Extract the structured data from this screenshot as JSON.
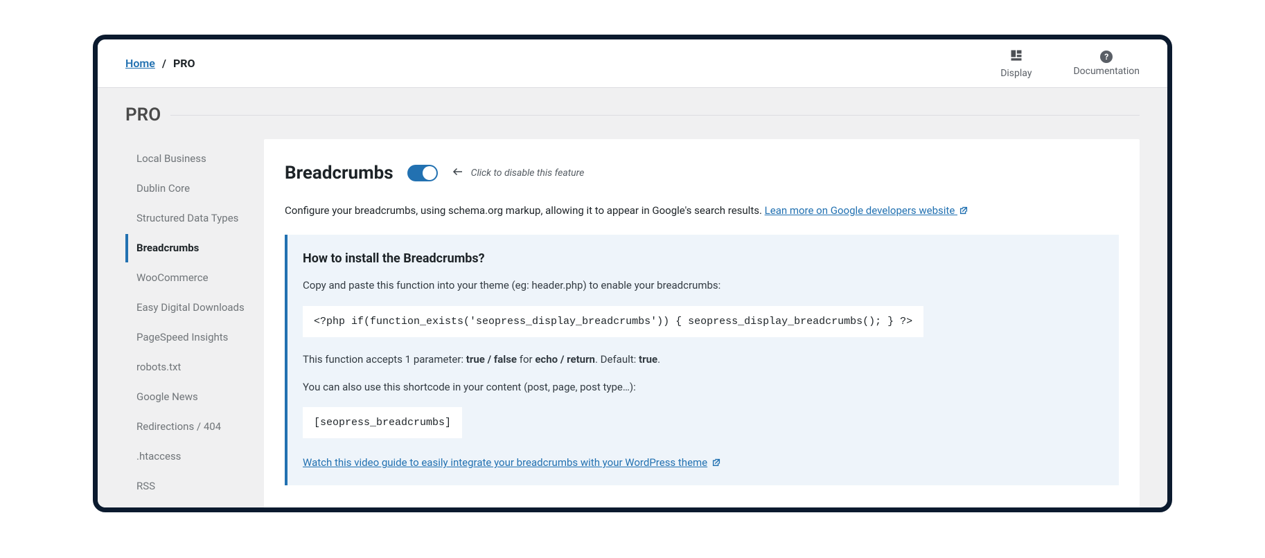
{
  "breadcrumb": {
    "home": "Home",
    "separator": "/",
    "current": "PRO"
  },
  "topbar": {
    "display": "Display",
    "documentation": "Documentation"
  },
  "page_title": "PRO",
  "sidebar": {
    "items": [
      {
        "label": "Local Business",
        "active": false
      },
      {
        "label": "Dublin Core",
        "active": false
      },
      {
        "label": "Structured Data Types",
        "active": false
      },
      {
        "label": "Breadcrumbs",
        "active": true
      },
      {
        "label": "WooCommerce",
        "active": false
      },
      {
        "label": "Easy Digital Downloads",
        "active": false
      },
      {
        "label": "PageSpeed Insights",
        "active": false
      },
      {
        "label": "robots.txt",
        "active": false
      },
      {
        "label": "Google News",
        "active": false
      },
      {
        "label": "Redirections / 404",
        "active": false
      },
      {
        "label": ".htaccess",
        "active": false
      },
      {
        "label": "RSS",
        "active": false
      }
    ]
  },
  "panel": {
    "title": "Breadcrumbs",
    "toggle_hint": "Click to disable this feature",
    "config_text_pre": "Configure your breadcrumbs, using schema.org markup, allowing it to appear in Google's search results. ",
    "config_link": "Lean more on Google developers website "
  },
  "info": {
    "heading": "How to install the Breadcrumbs?",
    "p1": "Copy and paste this function into your theme (eg: header.php) to enable your breadcrumbs:",
    "code1": "<?php if(function_exists('seopress_display_breadcrumbs')) { seopress_display_breadcrumbs(); } ?>",
    "p2_pre": "This function accepts 1 parameter: ",
    "p2_b1": "true / false",
    "p2_mid": " for ",
    "p2_b2": "echo / return",
    "p2_mid2": ". Default: ",
    "p2_b3": "true",
    "p2_post": ".",
    "p3": "You can also use this shortcode in your content (post, page, post type…):",
    "code2": "[seopress_breadcrumbs]",
    "video_link": "Watch this video guide to easily integrate your breadcrumbs with your WordPress theme"
  }
}
